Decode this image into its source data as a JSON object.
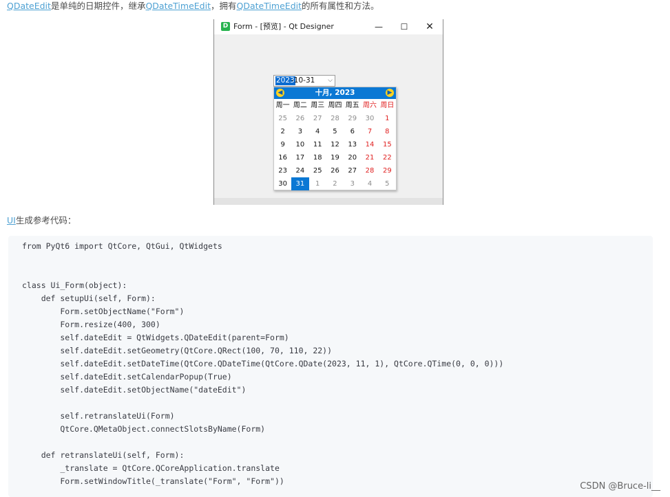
{
  "intro": {
    "link_qdateedit": "QDateEdit",
    "text1": "是单纯的日期控件，继承",
    "link_qdatetimeedit": "QDateTimeEdit",
    "text2": "，拥有",
    "link_qdatetimeedit2": "QDateTimeEdit",
    "text3": "的所有属性和方法。"
  },
  "window": {
    "icon_letter": "D",
    "title": "Form - [预览] - Qt Designer",
    "min_glyph": "—",
    "max_glyph": "☐",
    "close_glyph": "✕"
  },
  "date_edit": {
    "year": "2023",
    "rest": "-10-31",
    "arrow": "⌵"
  },
  "calendar": {
    "prev_glyph": "◀",
    "next_glyph": "▶",
    "month_label": "十月,  2023",
    "weekday_headers": [
      "周一",
      "周二",
      "周三",
      "周四",
      "周五",
      "周六",
      "周日"
    ],
    "weeks": [
      [
        "25",
        "26",
        "27",
        "28",
        "29",
        "30",
        "1"
      ],
      [
        "2",
        "3",
        "4",
        "5",
        "6",
        "7",
        "8"
      ],
      [
        "9",
        "10",
        "11",
        "12",
        "13",
        "14",
        "15"
      ],
      [
        "16",
        "17",
        "18",
        "19",
        "20",
        "21",
        "22"
      ],
      [
        "23",
        "24",
        "25",
        "26",
        "27",
        "28",
        "29"
      ],
      [
        "30",
        "31",
        "1",
        "2",
        "3",
        "4",
        "5"
      ]
    ],
    "selected_day": "31",
    "weekend_color": "#e02020",
    "selection_color": "#0b78d4"
  },
  "ui_caption": {
    "link": "UI",
    "text": "生成参考代码："
  },
  "code_lines": [
    "from PyQt6 import QtCore, QtGui, QtWidgets",
    "",
    "",
    "class Ui_Form(object):",
    "    def setupUi(self, Form):",
    "        Form.setObjectName(\"Form\")",
    "        Form.resize(400, 300)",
    "        self.dateEdit = QtWidgets.QDateEdit(parent=Form)",
    "        self.dateEdit.setGeometry(QtCore.QRect(100, 70, 110, 22))",
    "        self.dateEdit.setDateTime(QtCore.QDateTime(QtCore.QDate(2023, 11, 1), QtCore.QTime(0, 0, 0)))",
    "        self.dateEdit.setCalendarPopup(True)",
    "        self.dateEdit.setObjectName(\"dateEdit\")",
    "",
    "        self.retranslateUi(Form)",
    "        QtCore.QMetaObject.connectSlotsByName(Form)",
    "",
    "    def retranslateUi(self, Form):",
    "        _translate = QtCore.QCoreApplication.translate",
    "        Form.setWindowTitle(_translate(\"Form\", \"Form\"))"
  ],
  "watermark": "CSDN @Bruce-li__"
}
